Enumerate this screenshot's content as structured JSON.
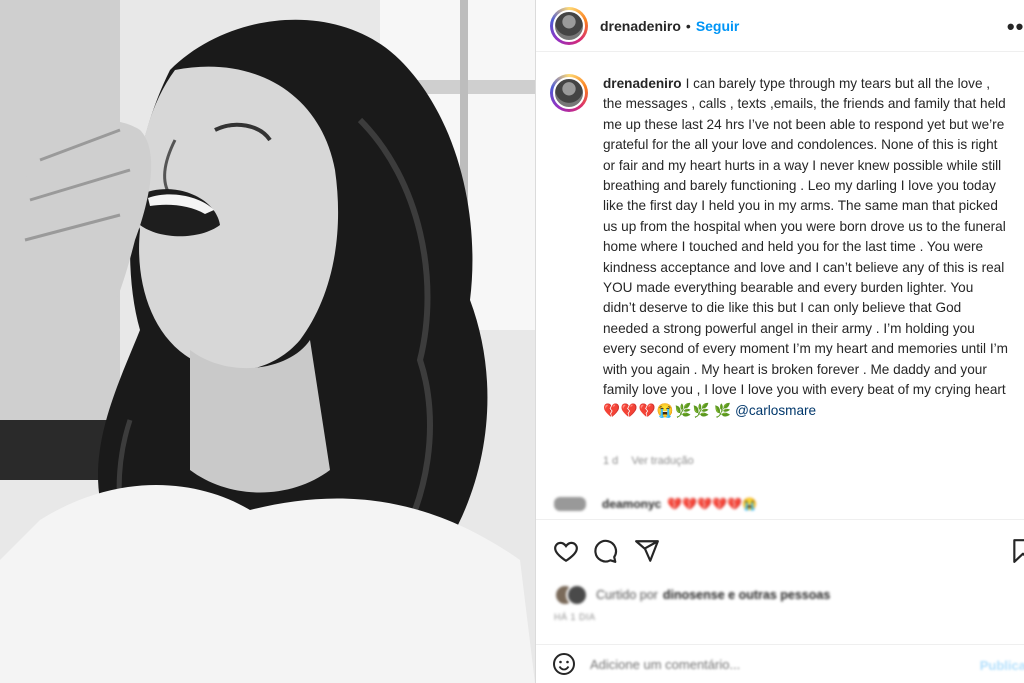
{
  "post": {
    "username": "drenadeniro",
    "separator": "•",
    "follow_label": "Seguir",
    "more_label": "•••"
  },
  "caption": {
    "username": "drenadeniro",
    "text": "I can barely type through my tears but all the love , the messages , calls , texts ,emails, the friends and family that held me up these last 24 hrs I’ve not been able to respond yet but we’re grateful for the all your love and condolences. None of this is right or fair and my heart hurts in a way I never knew possible while still breathing and barely functioning . Leo my darling I love you today like the first day I held you in my arms. The same man that picked us up from the hospital when you were born drove us to the funeral home where I touched and held you for the last time . You were kindness acceptance and love and I can’t believe any of this is real YOU made everything bearable and every burden lighter. You didn’t deserve to die like this but I can only believe that God needed a strong powerful angel in their army . I’m holding you every second of every moment I’m my heart and memories until I’m with you again . My heart is broken forever . Me daddy and your family love you , I love I love you with every beat of my crying heart",
    "emoji_trail": "💔💔💔😭🌿🌿",
    "emoji_lead": "🌿",
    "mention": "@carlosmare"
  },
  "caption_meta": {
    "time": "1 d",
    "translate": "Ver tradução"
  },
  "comment": {
    "username": "deamonyc",
    "text": "💔💔💔💔💔😭"
  },
  "actions": {
    "like_icon": "heart-icon",
    "comment_icon": "comment-icon",
    "share_icon": "share-icon",
    "save_icon": "bookmark-icon"
  },
  "likes": {
    "prefix": "Curtido por",
    "first_user": "dinosense",
    "suffix": "e outras pessoas"
  },
  "time_ago": "HÁ 1 DIA",
  "comment_box": {
    "emoji_icon": "smiley-icon",
    "placeholder": "Adicione um comentário...",
    "publish_label": "Publicar"
  }
}
